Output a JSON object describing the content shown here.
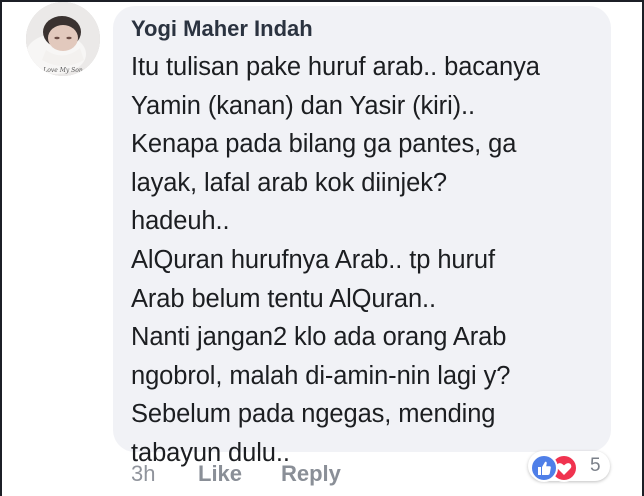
{
  "comment": {
    "author": "Yogi Maher Indah",
    "text": "Itu tulisan pake huruf arab.. bacanya\nYamin (kanan) dan Yasir (kiri)..\nKenapa pada bilang ga pantes, ga\nlayak, lafal arab kok diinjek?\nhadeuh..\nAlQuran hurufnya Arab.. tp huruf\nArab belum tentu AlQuran..\nNanti jangan2 klo ada orang Arab\nngobrol, malah di-amin-nin lagi y?\nSebelum pada ngegas, mending\ntabayun dulu..",
    "avatar_caption": "Love My Son",
    "timestamp": "3h",
    "like_label": "Like",
    "reply_label": "Reply"
  },
  "reactions": {
    "icons": [
      "like-icon",
      "love-icon"
    ],
    "count": "5",
    "colors": {
      "like": "#4f7fe8",
      "love": "#f0334f"
    }
  },
  "colors": {
    "bubble": "#f1f2f6",
    "author": "#2b3340",
    "text": "#1c1e21",
    "meta": "#90949c"
  }
}
